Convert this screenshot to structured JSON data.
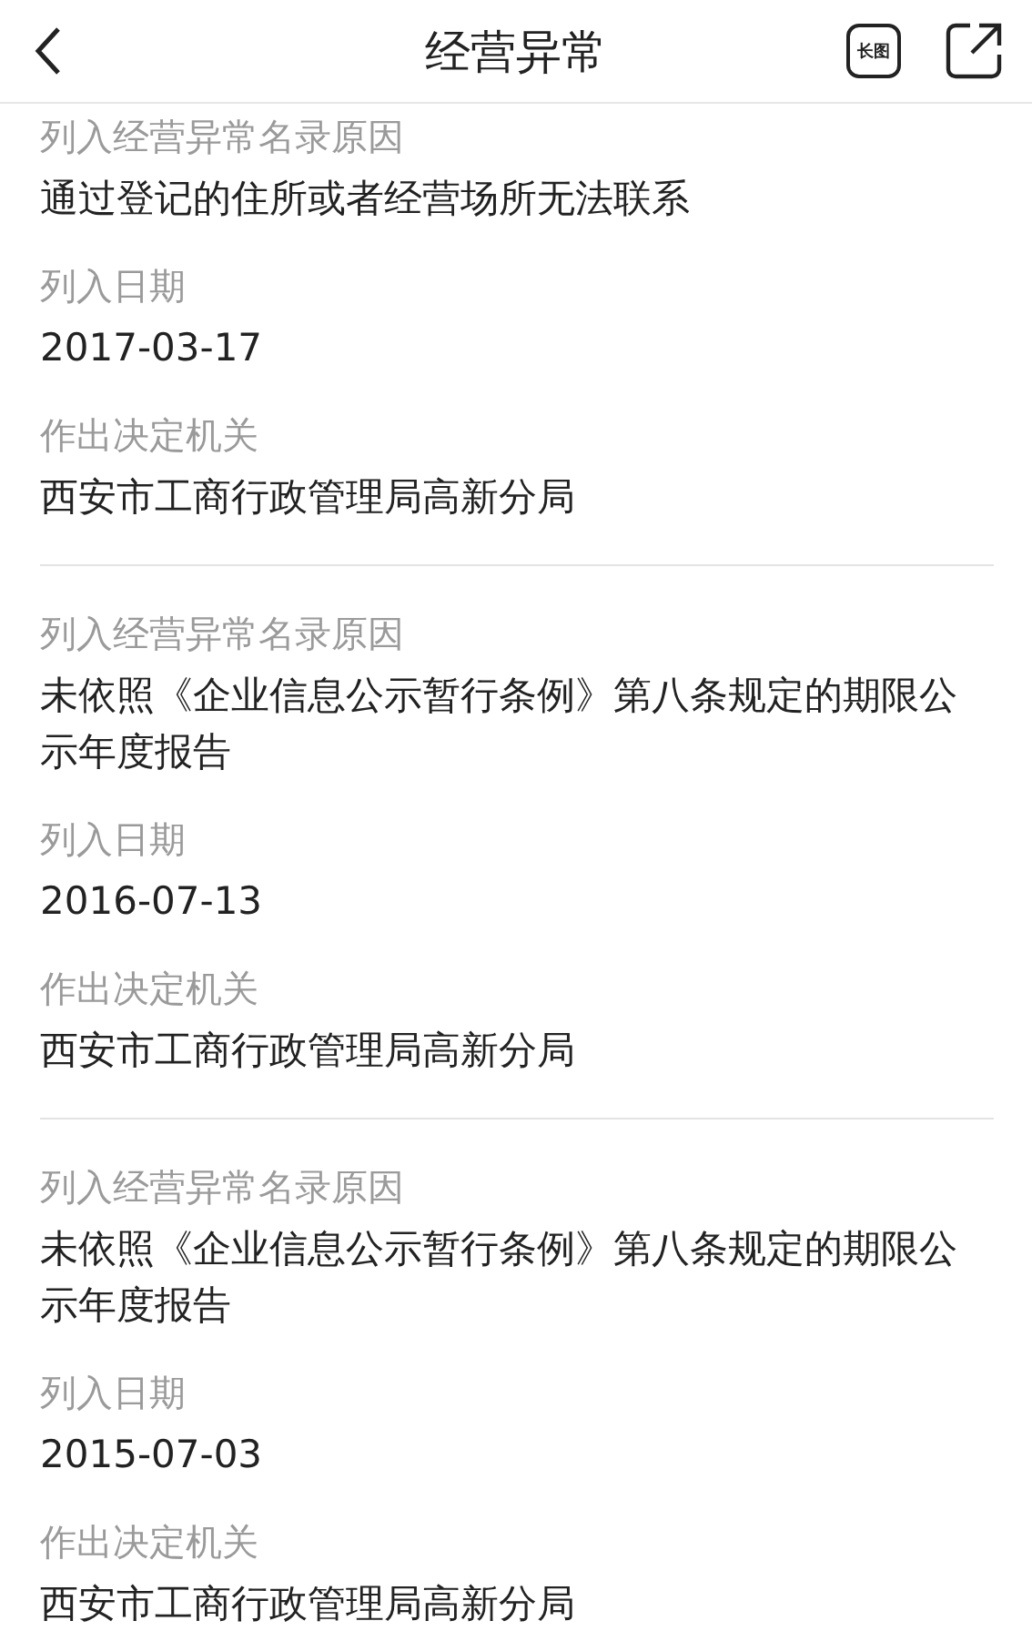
{
  "header": {
    "title": "经营异常",
    "long_image_label": "长图"
  },
  "records": [
    {
      "fields": [
        {
          "label": "列入经营异常名录原因",
          "value": "通过登记的住所或者经营场所无法联系"
        },
        {
          "label": "列入日期",
          "value": "2017-03-17"
        },
        {
          "label": "作出决定机关",
          "value": "西安市工商行政管理局高新分局"
        }
      ]
    },
    {
      "fields": [
        {
          "label": "列入经营异常名录原因",
          "value": "未依照《企业信息公示暂行条例》第八条规定的期限公示年度报告"
        },
        {
          "label": "列入日期",
          "value": "2016-07-13"
        },
        {
          "label": "作出决定机关",
          "value": "西安市工商行政管理局高新分局"
        }
      ]
    },
    {
      "fields": [
        {
          "label": "列入经营异常名录原因",
          "value": "未依照《企业信息公示暂行条例》第八条规定的期限公示年度报告"
        },
        {
          "label": "列入日期",
          "value": "2015-07-03"
        },
        {
          "label": "作出决定机关",
          "value": "西安市工商行政管理局高新分局"
        }
      ]
    }
  ]
}
